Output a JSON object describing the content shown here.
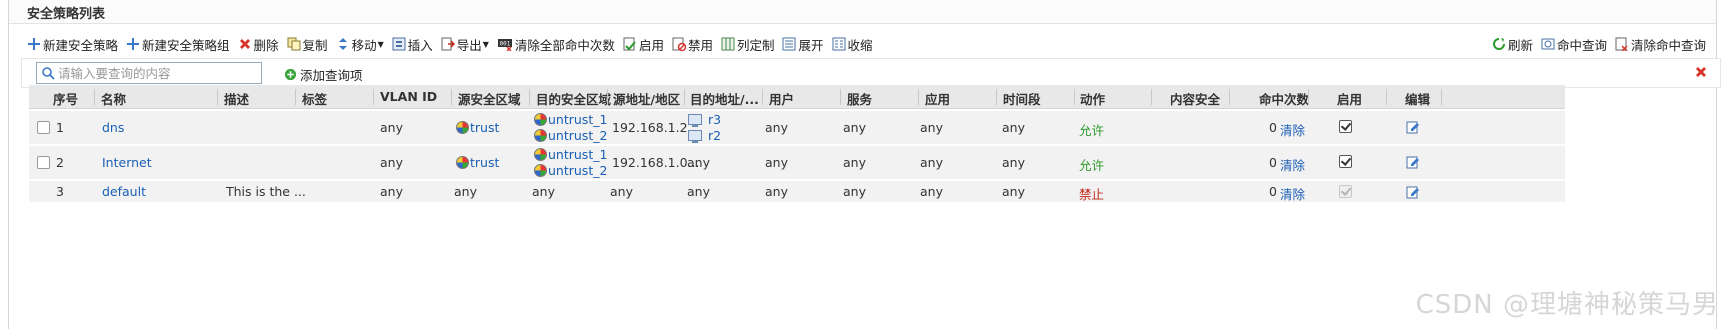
{
  "panel": {
    "title": "安全策略列表"
  },
  "toolbar": {
    "new_policy": "新建安全策略",
    "new_group": "新建安全策略组",
    "delete": "删除",
    "copy": "复制",
    "move": "移动",
    "insert": "插入",
    "export": "导出",
    "clear_all_hits": "清除全部命中次数",
    "enable": "启用",
    "disable": "禁用",
    "customize_columns": "列定制",
    "expand": "展开",
    "collapse": "收缩",
    "refresh": "刷新",
    "hit_query": "命中查询",
    "clear_hit_query": "清除命中查询"
  },
  "search": {
    "placeholder": "请输入要查询的内容",
    "add_filter": "添加查询项"
  },
  "columns": {
    "seq": "序号",
    "name": "名称",
    "desc": "描述",
    "tag": "标签",
    "vlan": "VLAN ID",
    "src_zone": "源安全区域",
    "dst_zone": "目的安全区域",
    "src_addr": "源地址/地区",
    "dst_addr": "目的地址/...",
    "user": "用户",
    "service": "服务",
    "app": "应用",
    "time": "时间段",
    "action": "动作",
    "content": "内容安全",
    "hits": "命中次数",
    "enabled": "启用",
    "edit": "编辑"
  },
  "rows": [
    {
      "seq": "1",
      "name": "dns",
      "desc": "",
      "tag": "",
      "vlan": "any",
      "src_zone": "trust",
      "dst_zone": [
        "untrust_1",
        "untrust_2"
      ],
      "src_addr": "192.168.1.2...",
      "dst_addr": [
        "r3",
        "r2"
      ],
      "user": "any",
      "service": "any",
      "app": "any",
      "time": "any",
      "action": "允许",
      "content": "",
      "hits": "0",
      "clear": "清除",
      "enabled": true
    },
    {
      "seq": "2",
      "name": "Internet",
      "desc": "",
      "tag": "",
      "vlan": "any",
      "src_zone": "trust",
      "dst_zone": [
        "untrust_1",
        "untrust_2"
      ],
      "src_addr": "192.168.1.0...",
      "dst_addr": [
        "any"
      ],
      "user": "any",
      "service": "any",
      "app": "any",
      "time": "any",
      "action": "允许",
      "content": "",
      "hits": "0",
      "clear": "清除",
      "enabled": true
    },
    {
      "seq": "3",
      "name": "default",
      "desc": "This is the ...",
      "tag": "",
      "vlan": "any",
      "src_zone": "any",
      "dst_zone": [
        "any"
      ],
      "src_addr": "any",
      "dst_addr": [
        "any"
      ],
      "user": "any",
      "service": "any",
      "app": "any",
      "time": "any",
      "action": "禁止",
      "content": "",
      "hits": "0",
      "clear": "清除",
      "enabled": true
    }
  ],
  "watermark": "CSDN @理塘神秘策马男",
  "colors": {
    "allow": "#2a9a2a",
    "deny": "#c0281a",
    "link": "#1a5fb4",
    "header_bg": "#e8e8e8",
    "row_bg": "#f2f2f2"
  }
}
